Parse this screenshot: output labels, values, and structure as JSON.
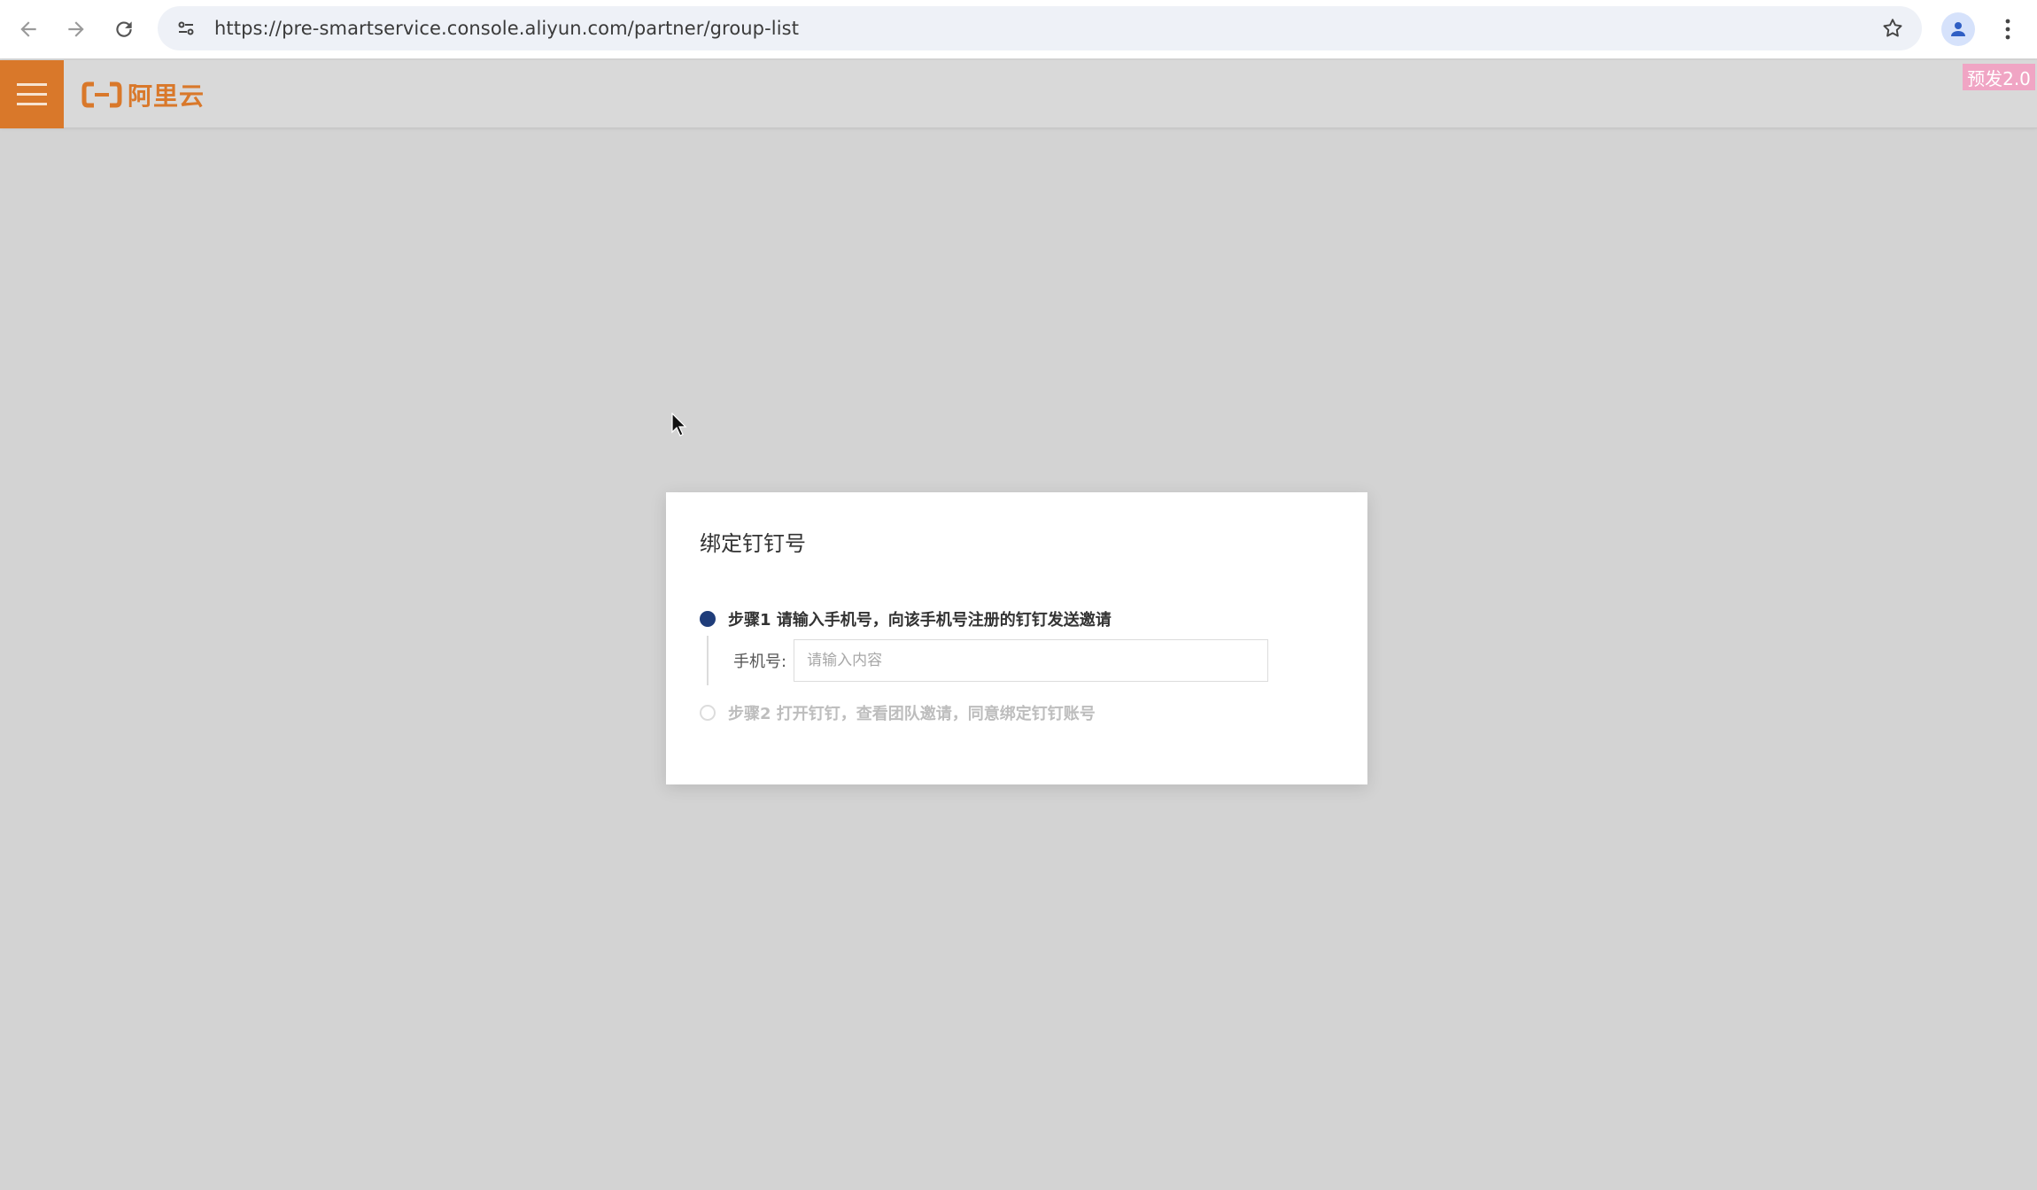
{
  "browser": {
    "url": "https://pre-smartservice.console.aliyun.com/partner/group-list",
    "icons": [
      "back-icon",
      "forward-icon",
      "reload-icon",
      "site-settings-icon",
      "bookmark-star-icon",
      "profile-icon",
      "more-vert-icon"
    ]
  },
  "header": {
    "brand_text": "阿里云",
    "env_badge": "预发2.0",
    "accent_color": "#d9782a"
  },
  "dialog": {
    "title": "绑定钉钉号",
    "step1": {
      "text": "步骤1 请输入手机号，向该手机号注册的钉钉发送邀请",
      "phone_label": "手机号:",
      "phone_value": "",
      "phone_placeholder": "请输入内容"
    },
    "step2": {
      "text": "步骤2 打开钉钉，查看团队邀请，同意绑定钉钉账号"
    },
    "active_step_color": "#1f3d7a"
  }
}
